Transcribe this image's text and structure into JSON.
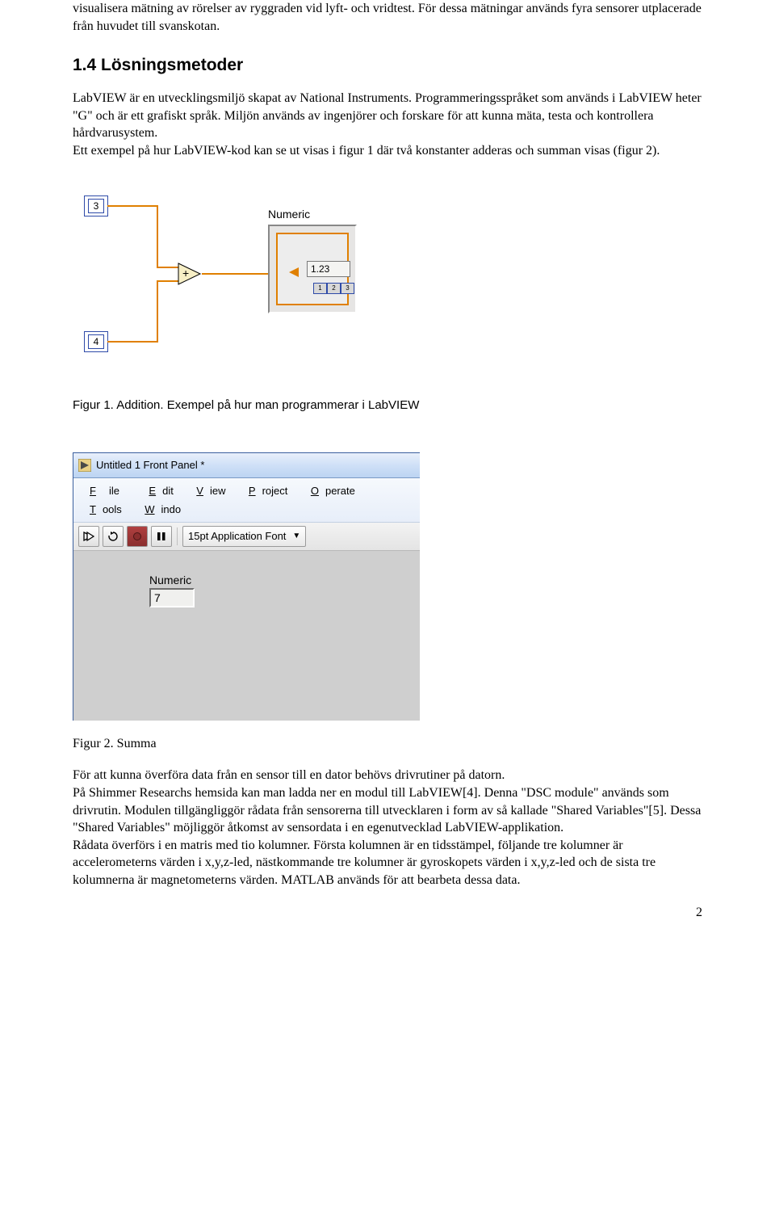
{
  "intro_paragraph": "visualisera mätning av rörelser av ryggraden vid lyft- och vridtest. För dessa mätningar används fyra sensorer utplacerade från huvudet till svanskotan.",
  "section_heading": "1.4 Lösningsmetoder",
  "body_paragraph": "LabVIEW är en utvecklingsmiljö skapat av National Instruments. Programmeringsspråket som används i LabVIEW heter \"G\" och är ett grafiskt språk. Miljön används av ingenjörer och forskare för att kunna mäta, testa och kontrollera hårdvarusystem.\nEtt exempel på hur LabVIEW-kod kan se ut visas i figur 1 där två konstanter adderas och summan visas (figur 2).",
  "fig1": {
    "const_a": "3",
    "const_b": "4",
    "indicator_label": "Numeric",
    "indicator_value": "1.23",
    "caption": "Figur 1. Addition. Exempel på hur man programmerar i LabVIEW"
  },
  "fig2": {
    "window_title": "Untitled 1 Front Panel *",
    "menu": {
      "file": "File",
      "edit": "Edit",
      "view": "View",
      "project": "Project",
      "operate": "Operate",
      "tools": "Tools",
      "window": "Windo"
    },
    "toolbar": {
      "run": "➪",
      "run_cont": "⟳",
      "pause": "▮▮",
      "font": "15pt Application Font"
    },
    "fp_label": "Numeric",
    "fp_value": "7",
    "caption": "Figur 2. Summa"
  },
  "closing_paragraph": "För att kunna överföra data från en sensor till en dator behövs drivrutiner på datorn.\nPå Shimmer Researchs hemsida kan man ladda ner en modul till LabVIEW[4]. Denna \"DSC module\" används som drivrutin. Modulen tillgängliggör rådata från sensorerna till utvecklaren i form av så kallade \"Shared Variables\"[5]. Dessa \"Shared Variables\" möjliggör åtkomst av sensordata i en egenutvecklad LabVIEW-applikation.\nRådata överförs i en matris med tio kolumner. Första kolumnen är en tidsstämpel, följande tre kolumner är accelerometerns värden i x,y,z-led, nästkommande tre kolumner är gyroskopets värden i x,y,z-led och de sista tre kolumnerna är magnetometerns värden. MATLAB används för att bearbeta dessa data.",
  "page_number": "2"
}
